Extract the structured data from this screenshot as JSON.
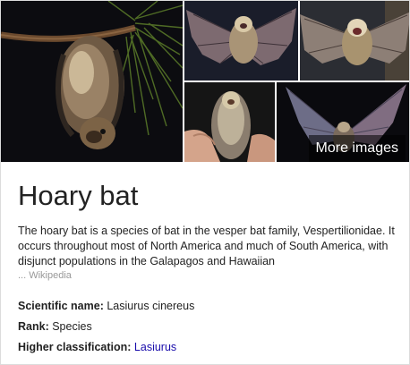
{
  "gallery": {
    "more_images_label": "More images",
    "image_subjects": [
      "bat-hanging-on-pine-branch",
      "bat-wings-spread",
      "bat-wings-spread-open-mouth",
      "bat-held-in-hand",
      "bat-in-flight-translucent-wings"
    ]
  },
  "entity": {
    "title": "Hoary bat",
    "description": "The hoary bat is a species of bat in the vesper bat family, Vespertilionidae. It occurs throughout most of North America and much of South America, with disjunct populations in the Galapagos and Hawaiian",
    "source_prefix": "... ",
    "source_label": "Wikipedia"
  },
  "facts": [
    {
      "label": "Scientific name:",
      "value": "Lasiurus cinereus",
      "is_link": false
    },
    {
      "label": "Rank:",
      "value": "Species",
      "is_link": false
    },
    {
      "label": "Higher classification:",
      "value": "Lasiurus",
      "is_link": true
    }
  ],
  "colors": {
    "link": "#1a0dab",
    "text": "#222222",
    "muted": "#999999"
  }
}
